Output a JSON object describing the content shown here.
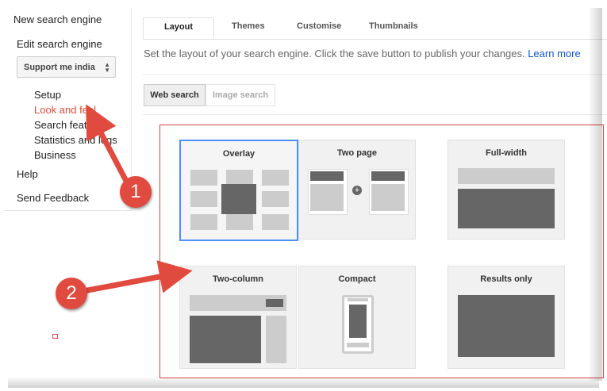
{
  "sidebar": {
    "new_engine": "New search engine",
    "edit_engine": "Edit search engine",
    "engine_select": "Support me india",
    "sub_items": [
      "Setup",
      "Look and feel",
      "Search features",
      "Statistics and logs",
      "Business"
    ],
    "help": "Help",
    "feedback": "Send Feedback"
  },
  "tabs": [
    "Layout",
    "Themes",
    "Customise",
    "Thumbnails"
  ],
  "description": "Set the layout of your search engine. Click the save button to publish your changes.",
  "learn_more": "Learn more",
  "search_type": {
    "web": "Web search",
    "image": "Image search"
  },
  "layouts": [
    "Overlay",
    "Two page",
    "Full-width",
    "Two-column",
    "Compact",
    "Results only"
  ],
  "annotations": [
    "1",
    "2"
  ],
  "colors": {
    "accent_red": "#dd4b39",
    "selected_blue": "#4d90fe",
    "link_blue": "#1155cc",
    "badge_red": "#e04a3f"
  }
}
